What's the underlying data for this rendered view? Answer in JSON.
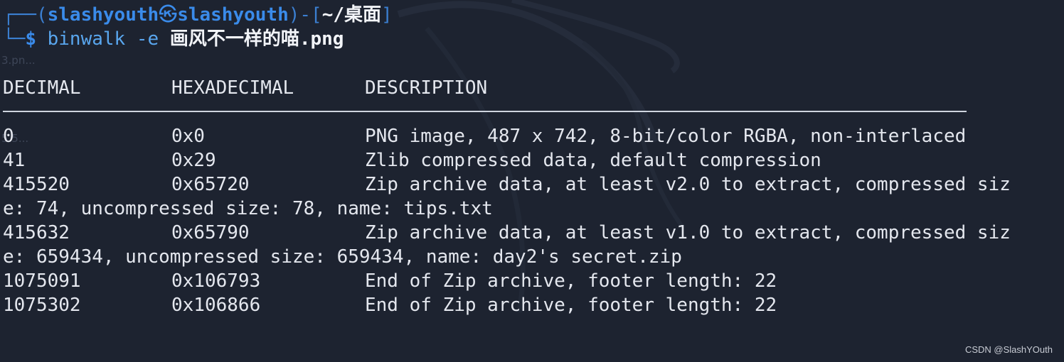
{
  "prompt": {
    "frame_top": "┌──",
    "open_paren": "(",
    "user": "slashyouth",
    "separator_glyph": "㉿",
    "host": "slashyouth",
    "close_paren": ")",
    "dash": "-",
    "open_bracket": "[",
    "cwd": "~/桌面",
    "close_bracket": "]",
    "frame_bottom": "└─",
    "dollar": "$",
    "command": "binwalk",
    "flag": "-e",
    "argument": "画风不一样的喵.png"
  },
  "ghost_text": {
    "a": "3.pn...",
    "b": "5.5..."
  },
  "headers": {
    "decimal": "DECIMAL",
    "hex": "HEXADECIMAL",
    "description": "DESCRIPTION"
  },
  "rows": [
    {
      "decimal": "0",
      "hex": "0x0",
      "description": "PNG image, 487 x 742, 8-bit/color RGBA, non-interlaced"
    },
    {
      "decimal": "41",
      "hex": "0x29",
      "description": "Zlib compressed data, default compression"
    },
    {
      "decimal": "415520",
      "hex": "0x65720",
      "description": "Zip archive data, at least v2.0 to extract, compressed siz"
    },
    {
      "wrap": "e: 74, uncompressed size: 78, name: tips.txt"
    },
    {
      "decimal": "415632",
      "hex": "0x65790",
      "description": "Zip archive data, at least v1.0 to extract, compressed siz"
    },
    {
      "wrap": "e: 659434, uncompressed size: 659434, name: day2's secret.zip"
    },
    {
      "decimal": "1075091",
      "hex": "0x106793",
      "description": "End of Zip archive, footer length: 22"
    },
    {
      "decimal": "1075302",
      "hex": "0x106866",
      "description": "End of Zip archive, footer length: 22"
    }
  ],
  "watermark": "CSDN @SlashYOuth",
  "colors": {
    "background": "#1d2330",
    "prompt_blue": "#3a8bea",
    "command_blue": "#59a6ee",
    "text": "#e4e7ee"
  }
}
